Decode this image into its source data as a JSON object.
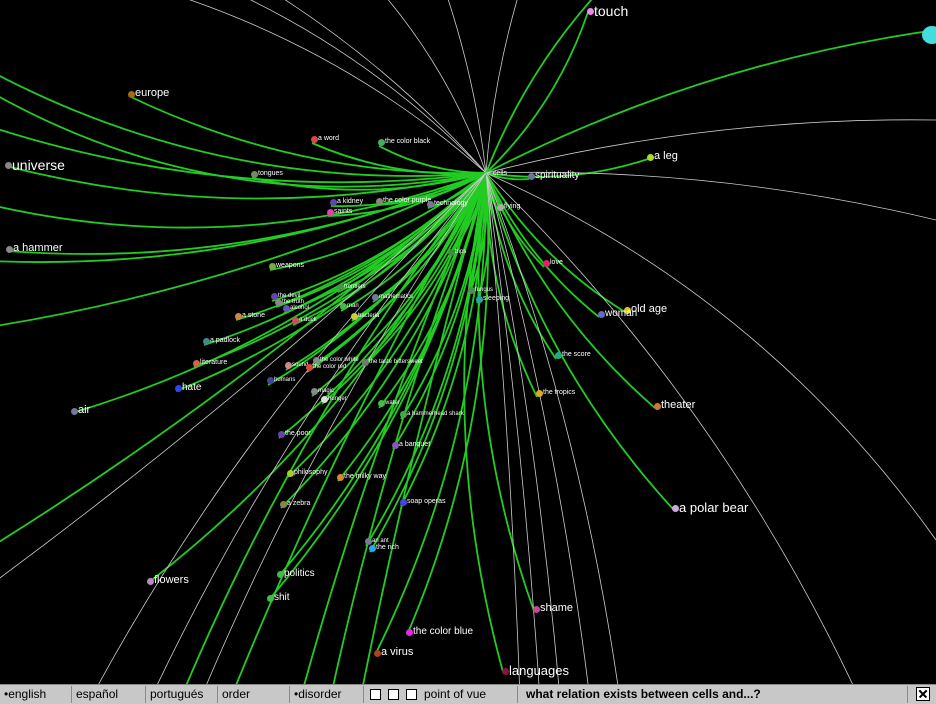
{
  "center": {
    "label": "cells"
  },
  "nodes": [
    {
      "label": "touch",
      "size": "xxl",
      "color": "#ee88ee"
    },
    {
      "label": "europe",
      "size": "l",
      "color": "#aa6611"
    },
    {
      "label": "universe",
      "size": "xxl",
      "color": "#888888"
    },
    {
      "label": "a word",
      "size": "s",
      "color": "#dd4444"
    },
    {
      "label": "the color black",
      "size": "s",
      "color": "#44aa66"
    },
    {
      "label": "a leg",
      "size": "l",
      "color": "#aadd22"
    },
    {
      "label": "tongues",
      "size": "s",
      "color": "#778866"
    },
    {
      "label": "spirituality",
      "size": "m",
      "color": "#667799"
    },
    {
      "label": "a kidney",
      "size": "s",
      "color": "#6644aa"
    },
    {
      "label": "the color purple",
      "size": "s",
      "color": "#888877"
    },
    {
      "label": "technology",
      "size": "s",
      "color": "#777799"
    },
    {
      "label": "flying",
      "size": "s",
      "color": "#aaaaaa"
    },
    {
      "label": "saints",
      "size": "s",
      "color": "#dd44aa"
    },
    {
      "label": "a hammer",
      "size": "l",
      "color": "#888888"
    },
    {
      "label": "trips",
      "size": "xs",
      "color": "#448844"
    },
    {
      "label": "love",
      "size": "s",
      "color": "#dd2266"
    },
    {
      "label": "weapons",
      "size": "s",
      "color": "#77aa44"
    },
    {
      "label": "frontiers",
      "size": "xs",
      "color": "#449944"
    },
    {
      "label": "fungus",
      "size": "xs",
      "color": "#558855"
    },
    {
      "label": "sleeping",
      "size": "s",
      "color": "#22aaaa"
    },
    {
      "label": "the devil",
      "size": "xs",
      "color": "#6644aa"
    },
    {
      "label": "mathematics",
      "size": "xs",
      "color": "#777799"
    },
    {
      "label": "old age",
      "size": "l",
      "color": "#ddcc22"
    },
    {
      "label": "woman",
      "size": "m",
      "color": "#6666cc"
    },
    {
      "label": "the truth",
      "size": "xs",
      "color": "#888888"
    },
    {
      "label": "alcohol",
      "size": "xs",
      "color": "#6655bb"
    },
    {
      "label": "man",
      "size": "xs",
      "color": "#44bb44"
    },
    {
      "label": "a stone",
      "size": "s",
      "color": "#cc8844"
    },
    {
      "label": "a duck",
      "size": "xs",
      "color": "#dd4466"
    },
    {
      "label": "bacteria",
      "size": "xs",
      "color": "#cccc44"
    },
    {
      "label": "a padlock",
      "size": "s",
      "color": "#448888"
    },
    {
      "label": "the score",
      "size": "s",
      "color": "#22aa88"
    },
    {
      "label": "literature",
      "size": "s",
      "color": "#cc6644"
    },
    {
      "label": "the color white",
      "size": "xs",
      "color": "#888888"
    },
    {
      "label": "the taste bittersweet",
      "size": "xs",
      "color": "#777777"
    },
    {
      "label": "sound",
      "size": "xs",
      "color": "#cc8888"
    },
    {
      "label": "the color red",
      "size": "xs",
      "color": "#dd4444"
    },
    {
      "label": "humans",
      "size": "xs",
      "color": "#444499"
    },
    {
      "label": "hate",
      "size": "m",
      "color": "#3344ee"
    },
    {
      "label": "the tropics",
      "size": "s",
      "color": "#ddaa22"
    },
    {
      "label": "magic",
      "size": "xs",
      "color": "#888888"
    },
    {
      "label": "hunger",
      "size": "xs",
      "color": "#dddddd"
    },
    {
      "label": "theater",
      "size": "l",
      "color": "#cc7733"
    },
    {
      "label": "air",
      "size": "l",
      "color": "#777799"
    },
    {
      "label": "water",
      "size": "xs",
      "color": "#44bb44"
    },
    {
      "label": "a hammerhead shark",
      "size": "xs",
      "color": "#44aa44"
    },
    {
      "label": "the poor",
      "size": "s",
      "color": "#6644aa"
    },
    {
      "label": "a banquet",
      "size": "s",
      "color": "#8855bb"
    },
    {
      "label": "philosophy",
      "size": "s",
      "color": "#aacc22"
    },
    {
      "label": "the milky way",
      "size": "s",
      "color": "#dd8822"
    },
    {
      "label": "soap operas",
      "size": "s",
      "color": "#4444ee"
    },
    {
      "label": "a zebra",
      "size": "s",
      "color": "#888844"
    },
    {
      "label": "a polar bear",
      "size": "xl",
      "color": "#ccaadd"
    },
    {
      "label": "an ant",
      "size": "xs",
      "color": "#777799"
    },
    {
      "label": "the rich",
      "size": "s",
      "color": "#22aaee"
    },
    {
      "label": "politics",
      "size": "m",
      "color": "#44bb44"
    },
    {
      "label": "flowers",
      "size": "l",
      "color": "#bb88cc"
    },
    {
      "label": "shit",
      "size": "m",
      "color": "#44bb44"
    },
    {
      "label": "shame",
      "size": "l",
      "color": "#cc4499"
    },
    {
      "label": "the color blue",
      "size": "m",
      "color": "#ee22ee"
    },
    {
      "label": "a virus",
      "size": "l",
      "color": "#aa4411"
    },
    {
      "label": "languages",
      "size": "xl",
      "color": "#881144"
    }
  ],
  "toolbar": {
    "lang_english": "english",
    "lang_espanol": "español",
    "lang_portugues": "portugués",
    "order": "order",
    "disorder": "disorder",
    "point_of_view": "point of vue",
    "question": "what relation exists between cells and...?"
  },
  "colors": {
    "green_edge": "#22cc22",
    "grey_edge": "#cccccc",
    "background": "#000000",
    "toolbar": "#c8c8c8",
    "offscreen_node": "#44dddd"
  }
}
